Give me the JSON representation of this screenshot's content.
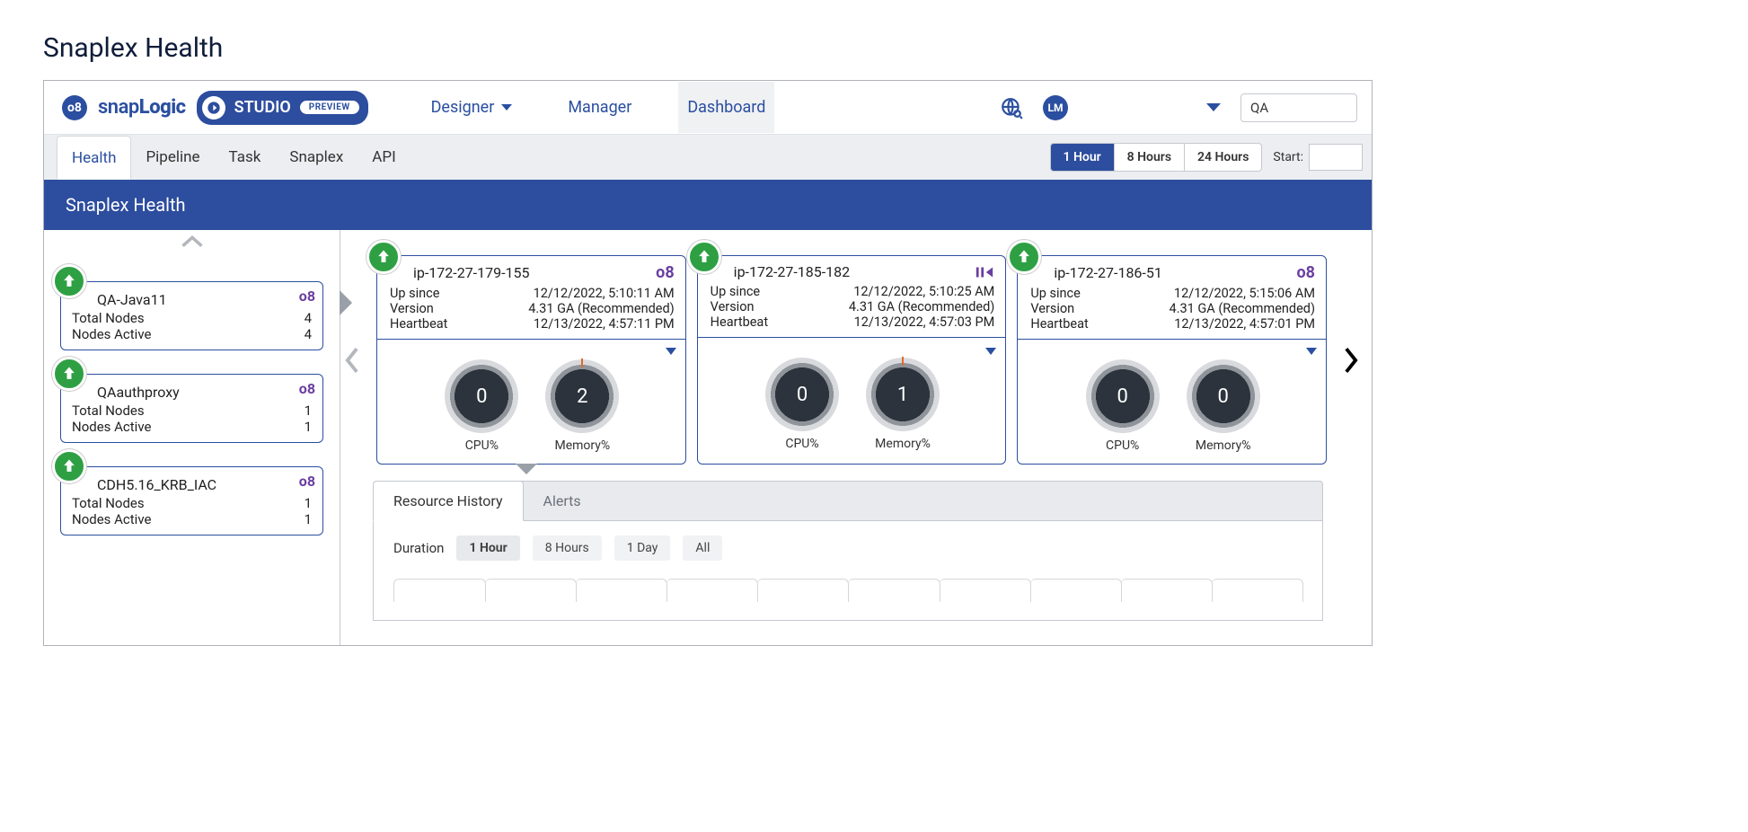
{
  "page": {
    "title": "Snaplex Health"
  },
  "brand": {
    "logo_glyph": "o8",
    "word_a": "snap",
    "word_b": "Logic",
    "studio_label": "STUDIO",
    "preview_chip": "PREVIEW"
  },
  "main_tabs": {
    "designer": "Designer",
    "manager": "Manager",
    "dashboard": "Dashboard"
  },
  "top_right": {
    "avatar_initials": "LM",
    "context": "QA"
  },
  "sub_tabs": {
    "health": "Health",
    "pipeline": "Pipeline",
    "task": "Task",
    "snaplex": "Snaplex",
    "api": "API"
  },
  "timerange": {
    "h1": "1 Hour",
    "h8": "8 Hours",
    "h24": "24 Hours",
    "start_label": "Start:"
  },
  "panel": {
    "title": "Snaplex Health"
  },
  "sidebar": {
    "label_total": "Total Nodes",
    "label_active": "Nodes Active",
    "items": [
      {
        "name": "QA-Java11",
        "total": "4",
        "active": "4"
      },
      {
        "name": "QAauthproxy",
        "total": "1",
        "active": "1"
      },
      {
        "name": "CDH5.16_KRB_IAC",
        "total": "1",
        "active": "1"
      }
    ]
  },
  "nodes": {
    "label_upsince": "Up since",
    "label_version": "Version",
    "label_heartbeat": "Heartbeat",
    "label_cpu": "CPU%",
    "label_mem": "Memory%",
    "items": [
      {
        "name": "ip-172-27-179-155",
        "up_since": "12/12/2022, 5:10:11 AM",
        "version": "4.31 GA (Recommended)",
        "heartbeat": "12/13/2022, 4:57:11 PM",
        "cpu": "0",
        "mem": "2",
        "outgoing": false,
        "selected": true
      },
      {
        "name": "ip-172-27-185-182",
        "up_since": "12/12/2022, 5:10:25 AM",
        "version": "4.31 GA (Recommended)",
        "heartbeat": "12/13/2022, 4:57:03 PM",
        "cpu": "0",
        "mem": "1",
        "outgoing": true,
        "selected": false
      },
      {
        "name": "ip-172-27-186-51",
        "up_since": "12/12/2022, 5:15:06 AM",
        "version": "4.31 GA (Recommended)",
        "heartbeat": "12/13/2022, 4:57:01 PM",
        "cpu": "0",
        "mem": "0",
        "outgoing": false,
        "selected": false
      }
    ]
  },
  "detail_tabs": {
    "resource_history": "Resource History",
    "alerts": "Alerts"
  },
  "duration": {
    "label": "Duration",
    "h1": "1 Hour",
    "h8": "8 Hours",
    "d1": "1 Day",
    "all": "All"
  }
}
